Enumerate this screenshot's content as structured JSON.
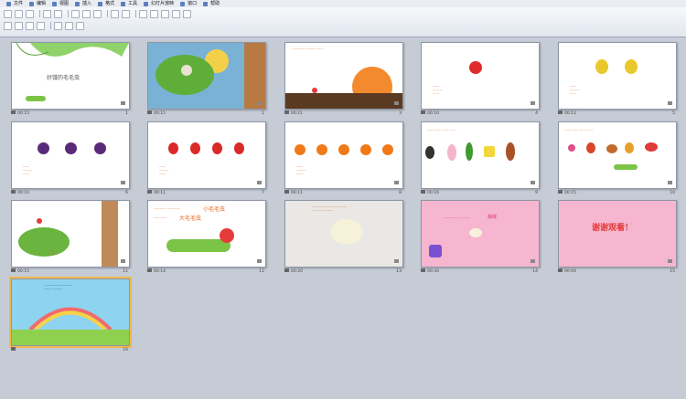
{
  "menu": [
    {
      "label": "文件"
    },
    {
      "label": "编辑"
    },
    {
      "label": "视图"
    },
    {
      "label": "插入"
    },
    {
      "label": "格式"
    },
    {
      "label": "工具"
    },
    {
      "label": "幻灯片放映"
    },
    {
      "label": "窗口"
    },
    {
      "label": "帮助"
    }
  ],
  "slides": [
    {
      "num": "1",
      "time": "00:15",
      "title": "好饿的毛毛虫"
    },
    {
      "num": "2",
      "time": "00:15"
    },
    {
      "num": "3",
      "time": "00:21"
    },
    {
      "num": "4",
      "time": "00:10"
    },
    {
      "num": "5",
      "time": "00:12"
    },
    {
      "num": "6",
      "time": "00:10"
    },
    {
      "num": "7",
      "time": "00:11"
    },
    {
      "num": "8",
      "time": "00:11"
    },
    {
      "num": "9",
      "time": "00:16"
    },
    {
      "num": "10",
      "time": "00:15"
    },
    {
      "num": "11",
      "time": "00:15"
    },
    {
      "num": "12",
      "time": "00:14",
      "line1": "小毛毛虫",
      "line2": "大毛毛虫"
    },
    {
      "num": "13",
      "time": "00:20"
    },
    {
      "num": "14",
      "time": "00:30",
      "badge": "蝴蝶"
    },
    {
      "num": "15",
      "time": "00:04",
      "title": "谢谢观看！"
    },
    {
      "num": "16"
    }
  ]
}
